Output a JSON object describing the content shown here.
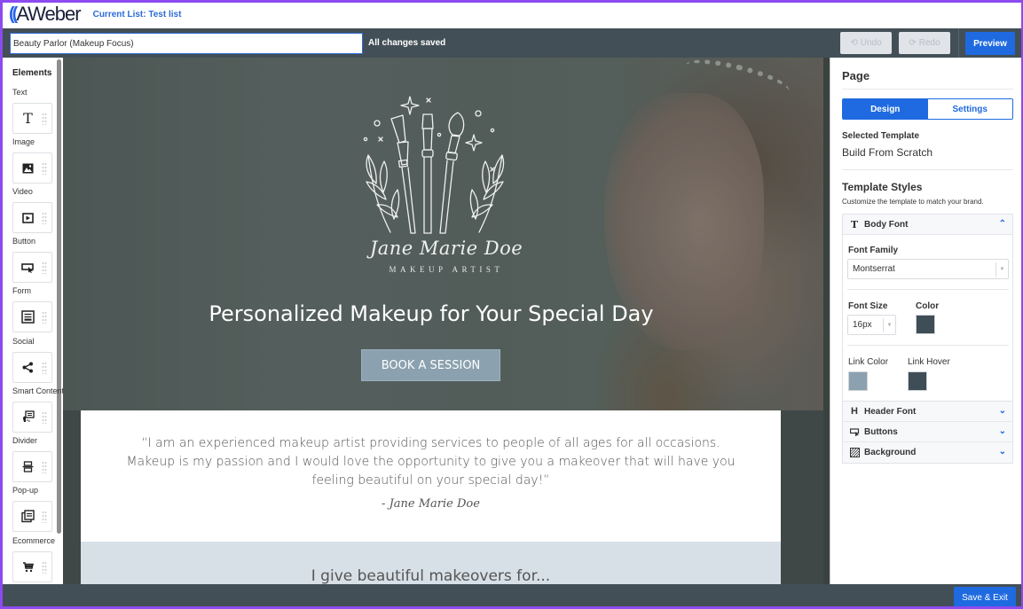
{
  "app": {
    "brand": "AWeber",
    "current_list": "Current List: Test list"
  },
  "toolbar": {
    "page_name": "Beauty Parlor (Makeup Focus)",
    "save_status": "All changes saved",
    "undo_label": "Undo",
    "redo_label": "Redo",
    "preview_label": "Preview"
  },
  "sidebar": {
    "title": "Elements",
    "items": [
      {
        "label": "Text",
        "icon": "text-icon"
      },
      {
        "label": "Image",
        "icon": "image-icon"
      },
      {
        "label": "Video",
        "icon": "video-icon"
      },
      {
        "label": "Button",
        "icon": "button-icon"
      },
      {
        "label": "Form",
        "icon": "form-icon"
      },
      {
        "label": "Social",
        "icon": "share-icon"
      },
      {
        "label": "Smart Content",
        "icon": "smart-content-icon"
      },
      {
        "label": "Divider",
        "icon": "divider-icon"
      },
      {
        "label": "Pop-up",
        "icon": "popup-icon"
      },
      {
        "label": "Ecommerce",
        "icon": "cart-icon"
      }
    ]
  },
  "canvas": {
    "artist_name": "Jane Marie Doe",
    "artist_role": "MAKEUP ARTIST",
    "hero_title": "Personalized Makeup for Your Special Day",
    "hero_button": "BOOK A SESSION",
    "quote": "“I am an experienced makeup artist providing services to people of all ages for all occasions. Makeup is my passion and I would love the opportunity to give you a makeover that will have you feeling beautiful on your special day!”",
    "quote_signature": "- Jane Marie Doe",
    "section_title": "I give beautiful makeovers for..."
  },
  "panel": {
    "title": "Page",
    "tabs": [
      {
        "label": "Design",
        "active": true
      },
      {
        "label": "Settings",
        "active": false
      }
    ],
    "selected_template_label": "Selected Template",
    "selected_template_value": "Build From Scratch",
    "template_styles_title": "Template Styles",
    "template_styles_hint": "Customize the template to match your brand.",
    "body_font": {
      "label": "Body Font",
      "font_family_label": "Font Family",
      "font_family_value": "Montserrat",
      "font_size_label": "Font Size",
      "font_size_value": "16px",
      "color_label": "Color",
      "color_value": "#3f4d57",
      "link_color_label": "Link Color",
      "link_color_value": "#8ba1af",
      "link_hover_label": "Link Hover",
      "link_hover_value": "#3f4d57"
    },
    "accordions": [
      {
        "label": "Header Font",
        "icon": "header-icon"
      },
      {
        "label": "Buttons",
        "icon": "button-icon"
      },
      {
        "label": "Background",
        "icon": "background-icon"
      }
    ]
  },
  "footer": {
    "save_exit_label": "Save & Exit"
  },
  "colors": {
    "accent": "#1f6ae0",
    "toolbar_bg": "#434f56",
    "frame": "#8b4bf0"
  }
}
